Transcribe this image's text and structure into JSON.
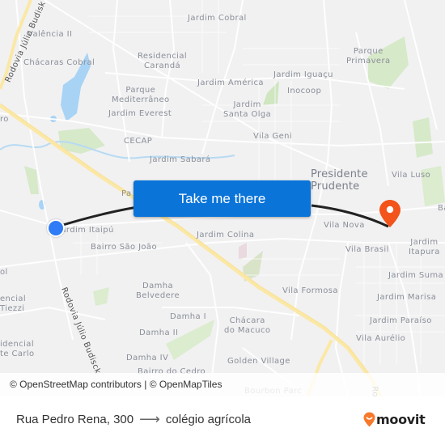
{
  "map": {
    "labels": {
      "valencia_ii": "Valência II",
      "chacaras_cobral": "Chácaras Cobral",
      "rodovia_top": "Rodovia Júlio Budisk",
      "jardim_cobral": "Jardim Cobral",
      "residencial_caranda_1": "Residencial",
      "residencial_caranda_2": "Carandá",
      "parque_mediterraneo_1": "Parque",
      "parque_mediterraneo_2": "Mediterrâneo",
      "jardim_everest": "Jardim Everest",
      "cecap": "CECAP",
      "jardim_sabara": "Jardim Sabará",
      "jardim_america": "Jardim América",
      "jardim_iguacu": "Jardim Iguaçu",
      "inocoop": "Inocoop",
      "jardim_santa_olga_1": "Jardim",
      "jardim_santa_olga_2": "Santa Olga",
      "vila_geni": "Vila Geni",
      "parque_primavera_1": "Parque",
      "parque_primavera_2": "Primavera",
      "presidente_prudente_1": "Presidente",
      "presidente_prudente_2": "Prudente",
      "vila_luso": "Vila Luso",
      "ba": "Ba",
      "ro": "ro",
      "pa": "Pa",
      "jardim_itaipu": "Jardim Itaipú",
      "bairro_sao_joao": "Bairro São João",
      "jardim_colina": "Jardim Colina",
      "vila_nova": "Vila Nova",
      "vila_brasil": "Vila Brasil",
      "jardim_itapura_1": "Jardim",
      "jardim_itapura_2": "Itapura",
      "jardim_suma": "Jardim Suma",
      "jardim_marisa": "Jardim Marisa",
      "vila_formosa": "Vila Formosa",
      "jardim_paraiso": "Jardim Paraíso",
      "vila_aurelio": "Vila Aurélio",
      "ol": "ol",
      "encial_tiezzi_1": "encial",
      "encial_tiezzi_2": "Tiezzi",
      "idencial_carlo_1": "idencial",
      "idencial_carlo_2": "te Carlo",
      "rodovia_bottom": "Rodovia Júlio Budisck",
      "damha_belvedere_1": "Damha",
      "damha_belvedere_2": "Belvedere",
      "damha_i": "Damha I",
      "damha_ii": "Damha II",
      "damha_iv": "Damha IV",
      "chacara_macuco_1": "Chácara",
      "chacara_macuco_2": "do Macuco",
      "golden_village": "Golden Village",
      "bairro_do_cedro": "Bairro do Cedro",
      "bourbon_parc": "Bourbon Parc",
      "ro_bottom": "Ro"
    },
    "cta_label": "Take me there",
    "attribution": "© OpenStreetMap contributors | © OpenMapTiles",
    "colors": {
      "cta": "#0a74d9",
      "origin": "#2f7cf6",
      "destination": "#f2541b",
      "route": "#222222",
      "highway": "#fbe8a6",
      "water": "#a8d3f5",
      "park": "#cfe6c0"
    }
  },
  "footer": {
    "origin": "Rua Pedro Rena, 300",
    "arrow": "⟶",
    "destination": "colégio agrícola",
    "brand": "moovit",
    "brand_color": "#f7792b"
  }
}
